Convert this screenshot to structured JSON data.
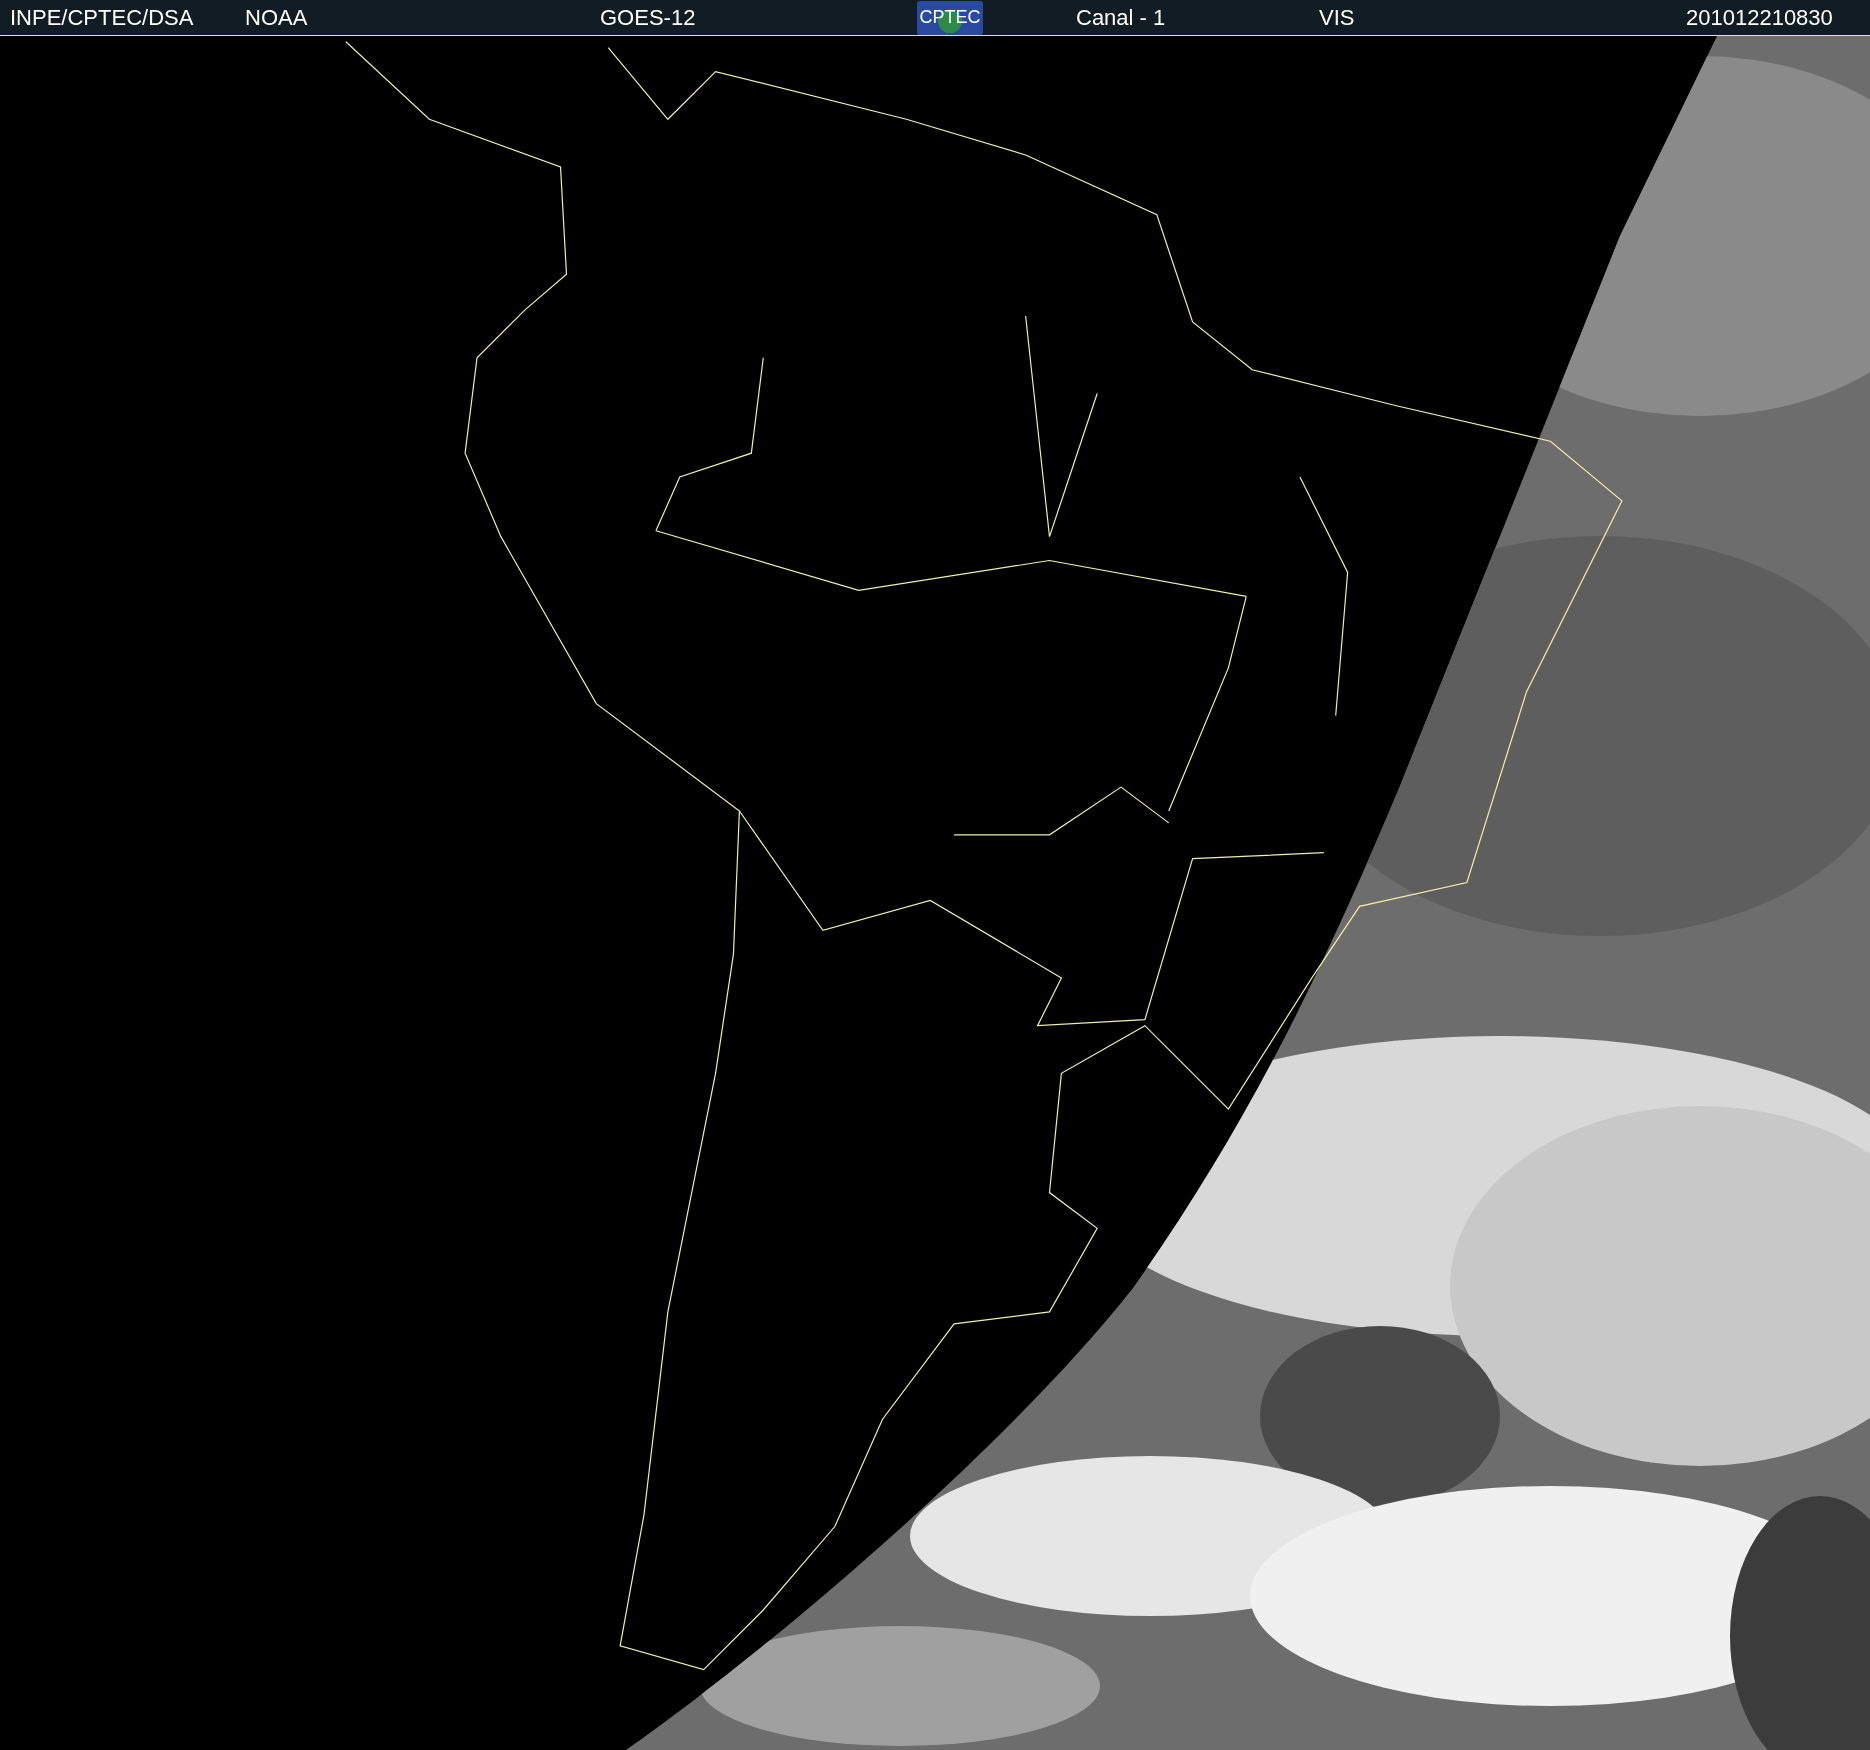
{
  "header": {
    "source": "INPE/CPTEC/DSA",
    "agency": "NOAA",
    "satellite": "GOES-12",
    "logo": "CPTEC",
    "channel": "Canal - 1",
    "band": "VIS",
    "timestamp": "201012210830"
  }
}
